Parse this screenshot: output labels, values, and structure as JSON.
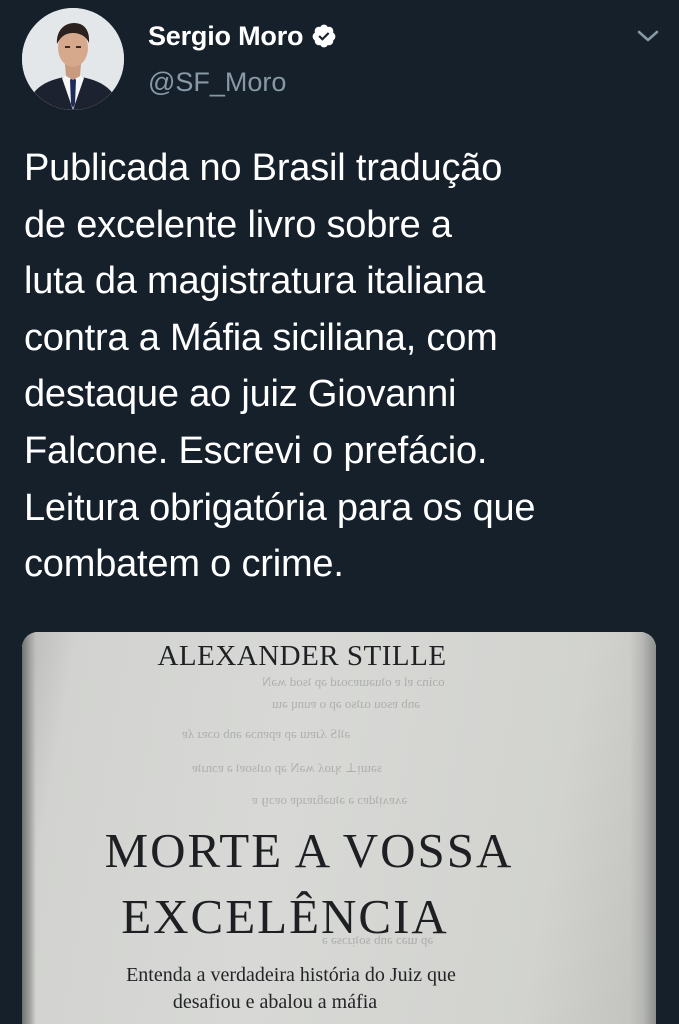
{
  "author": {
    "display_name": "Sergio Moro",
    "handle": "@SF_Moro",
    "verified": true
  },
  "icons": {
    "verified": "verified-badge-icon",
    "menu": "chevron-down-icon"
  },
  "tweet": {
    "text": "Publicada no Brasil tradução\nde excelente livro sobre a\nluta da magistratura italiana\ncontra a Máfia siciliana, com\ndestaque ao juiz Giovanni\nFalcone. Escrevi o prefácio.\nLeitura obrigatória para os que\ncombatem o crime."
  },
  "media": {
    "book_author": "ALEXANDER STILLE",
    "title_line_1": "MORTE A VOSSA",
    "title_line_2": "EXCELÊNCIA",
    "subtitle_line_1": "Entenda a verdadeira história do Juiz que",
    "subtitle_line_2": "desafiou e abalou a máfia"
  },
  "colors": {
    "background": "#15202b",
    "text_primary": "#ffffff",
    "text_secondary": "#8899a6",
    "verified_badge": "#ffffff"
  }
}
